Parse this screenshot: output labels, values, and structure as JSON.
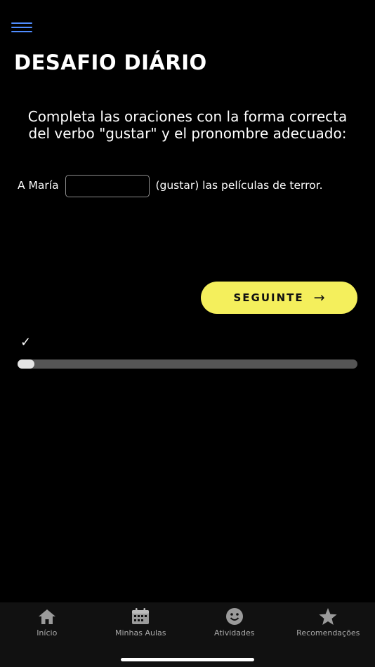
{
  "header": {
    "menu_icon": "hamburger-menu-icon",
    "title": "DESAFIO DIÁRIO"
  },
  "exercise": {
    "instructions": "Completa las oraciones con la forma correcta del verbo \"gustar\" y el pronombre adecuado:",
    "sentence_before": "A María",
    "answer_value": "",
    "sentence_after": "(gustar) las películas de terror."
  },
  "actions": {
    "next_label": "SEGUINTE",
    "next_icon": "arrow-right-icon"
  },
  "progress": {
    "check_icon": "checkmark-icon",
    "fraction": 0.05
  },
  "tabbar": {
    "tabs": [
      {
        "label": "Início",
        "icon": "home-icon"
      },
      {
        "label": "Minhas Aulas",
        "icon": "calendar-icon"
      },
      {
        "label": "Atividades",
        "icon": "smiley-icon"
      },
      {
        "label": "Recomendações",
        "icon": "star-icon"
      }
    ]
  },
  "colors": {
    "accent_button": "#f4ef5c",
    "menu_icon": "#4f8cff",
    "background": "#000000"
  }
}
